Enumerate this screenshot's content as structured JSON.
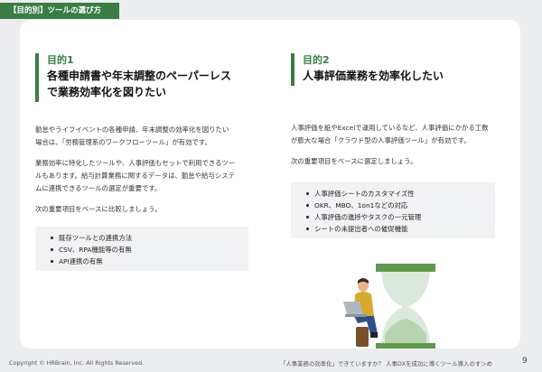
{
  "header": {
    "tag": "【目的別】ツールの選び方"
  },
  "left": {
    "label": "目的1",
    "title_lines": [
      "各種申請書や年末調整のペーパーレス",
      "で業務効率化を図りたい"
    ],
    "paragraphs": [
      [
        "勤怠やライフイベントの各種申請、年末調整の効率化を図りたい",
        "場合は、「労務管理系のワークフローツール」が有効です。"
      ],
      [
        "業務効率に特化したツールや、人事評価もセットで利用できるツー",
        "ルもあります。給与計算業務に関するデータは、勤怠や給与システ",
        "ムに連携できるツールの選定が重要です。"
      ],
      [
        "次の重要項目をベースに比較しましょう。"
      ]
    ],
    "list": [
      "既存ツールとの連携方法",
      "CSV、RPA機能等の有無",
      "API連携の有無"
    ]
  },
  "right": {
    "label": "目的2",
    "title_lines": [
      "人事評価業務を効率化したい"
    ],
    "paragraphs": [
      [
        "人事評価を紙やExcelで運用しているなど、人事評価にかかる工数",
        "が膨大な場合「クラウド型の人事評価ツール」が有効です。"
      ],
      [
        "次の重要項目をベースに選定しましょう。"
      ]
    ],
    "list": [
      "人事評価シートのカスタマイズ性",
      "OKR、MBO、1on1などの対応",
      "人事評価の進捗やタスクの一元管理",
      "シートの未提出者への催促機能"
    ]
  },
  "footer": {
    "copyright": "Copyright © HRBrain, Inc. All Rights Reserved.",
    "doc_title": "「人事業務の効率化」できていますか？ 人事DXを成功に導くツール導入のす＞め",
    "page": "9"
  },
  "colors": {
    "accent": "#3a7d44",
    "background": "#ecedef",
    "card": "#ffffff"
  }
}
